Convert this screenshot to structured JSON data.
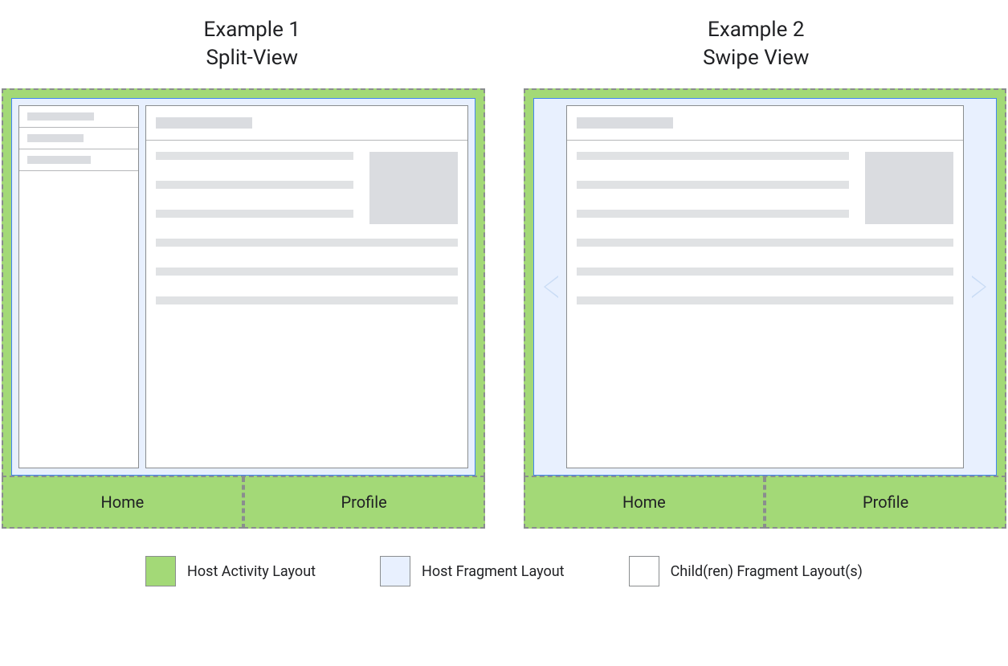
{
  "titles": {
    "ex1_l1": "Example 1",
    "ex1_l2": "Split-View",
    "ex2_l1": "Example 2",
    "ex2_l2": "Swipe View"
  },
  "tabs": {
    "home": "Home",
    "profile": "Profile"
  },
  "legend": {
    "host_activity": "Host Activity Layout",
    "host_fragment": "Host Fragment Layout",
    "child_fragment": "Child(ren) Fragment Layout(s)"
  },
  "colors": {
    "host_activity": "#a3d977",
    "host_fragment": "#e8f0fe",
    "child_fragment": "#ffffff",
    "dash_border": "#8a8d8f",
    "placeholder": "#dadce0"
  },
  "icons": {
    "arrow_left": "chevron-left-icon",
    "arrow_right": "chevron-right-icon"
  }
}
